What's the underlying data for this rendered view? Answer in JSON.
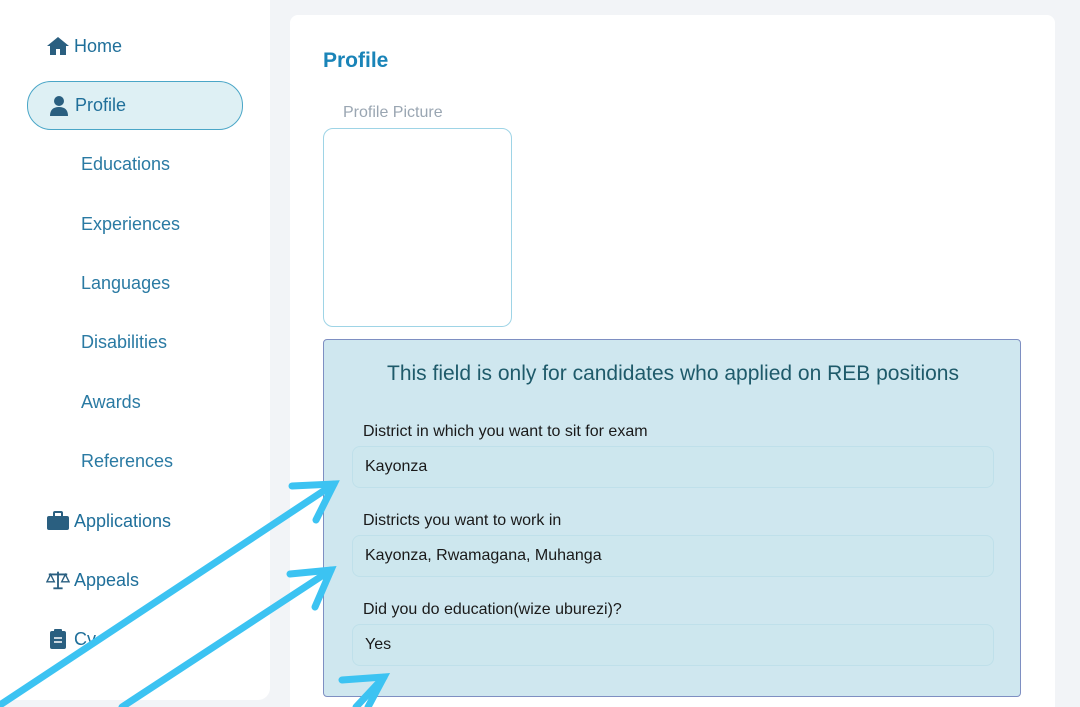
{
  "sidebar": {
    "home_label": "Home",
    "profile_label": "Profile",
    "sub_items": [
      "Educations",
      "Experiences",
      "Languages",
      "Disabilities",
      "Awards",
      "References"
    ],
    "applications_label": "Applications",
    "appeals_label": "Appeals",
    "cv_label": "Cv"
  },
  "main": {
    "title": "Profile",
    "picture_label": "Profile Picture",
    "reb_notice": "This field is only for candidates who applied on REB positions",
    "fields": [
      {
        "label": "District in which you want to sit for exam",
        "value": "Kayonza"
      },
      {
        "label": "Districts you want to work in",
        "value": "Kayonza, Rwamagana, Muhanga"
      },
      {
        "label": "Did you do education(wize uburezi)?",
        "value": "Yes"
      }
    ]
  },
  "colors": {
    "accent": "#1a84b8",
    "panel_bg": "#cfe7ef",
    "arrow": "#3cc3f2"
  }
}
